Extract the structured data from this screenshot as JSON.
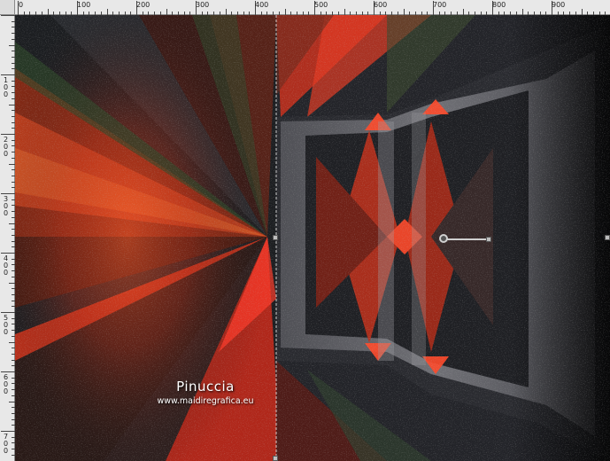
{
  "ruler": {
    "top_labels": [
      "0",
      "100",
      "200",
      "300",
      "400",
      "500",
      "600",
      "700",
      "800",
      "900"
    ],
    "left_labels": [
      "1 0 0",
      "2 0 0",
      "3 0 0",
      "4 0 0",
      "5 0 0",
      "6 0 0",
      "7 0 0"
    ]
  },
  "watermark": {
    "name": "Pinuccia",
    "url": "www.maidiregrafica.eu"
  },
  "colors": {
    "canvas_bg": "#1d1f22",
    "accent_red": "#e0301e",
    "accent_orange": "#d25a1e",
    "accent_green": "#2e5a2a",
    "frame_gray": "#8f8f95"
  },
  "icons": {
    "pivot": "rotation-pivot-icon"
  }
}
